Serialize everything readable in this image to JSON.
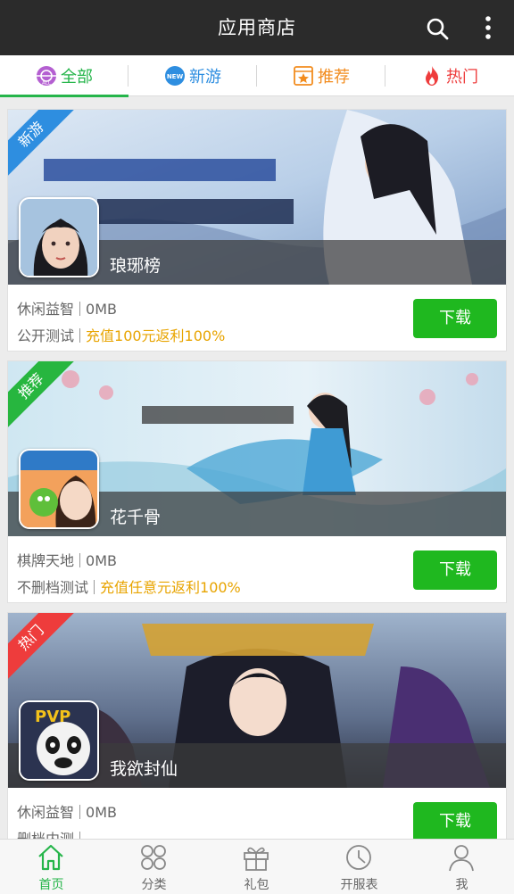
{
  "header": {
    "title": "应用商店"
  },
  "tabs": [
    {
      "label": "全部",
      "icon": "all-icon",
      "color": "#25b54a",
      "active": true
    },
    {
      "label": "新游",
      "icon": "new-icon",
      "color": "#2e8ee0",
      "active": false
    },
    {
      "label": "推荐",
      "icon": "star-icon",
      "color": "#f28c1e",
      "active": false
    },
    {
      "label": "热门",
      "icon": "flame-icon",
      "color": "#ee3c3c",
      "active": false
    }
  ],
  "cards": [
    {
      "ribbon": "新游",
      "ribbon_color": "#2e8ee0",
      "name": "琅琊榜",
      "category": "休闲益智",
      "size": "0MB",
      "status": "公开测试",
      "promo": "充值100元返利100%",
      "button": "下载"
    },
    {
      "ribbon": "推荐",
      "ribbon_color": "#27b63f",
      "name": "花千骨",
      "category": "棋牌天地",
      "size": "0MB",
      "status": "不删档测试",
      "promo": "充值任意元返利100%",
      "button": "下载"
    },
    {
      "ribbon": "热门",
      "ribbon_color": "#ee3c3c",
      "name": "我欲封仙",
      "category": "休闲益智",
      "size": "0MB",
      "status": "删档内测",
      "promo": "",
      "button": "下载"
    }
  ],
  "bottom_nav": [
    {
      "label": "首页",
      "icon": "home-icon",
      "active": true
    },
    {
      "label": "分类",
      "icon": "category-icon",
      "active": false
    },
    {
      "label": "礼包",
      "icon": "gift-icon",
      "active": false
    },
    {
      "label": "开服表",
      "icon": "clock-icon",
      "active": false
    },
    {
      "label": "我",
      "icon": "user-icon",
      "active": false
    }
  ],
  "colors": {
    "header_bg": "#2b2b2b",
    "accent": "#25b54a",
    "download_button": "#1fb81f",
    "promo": "#e8a400"
  }
}
